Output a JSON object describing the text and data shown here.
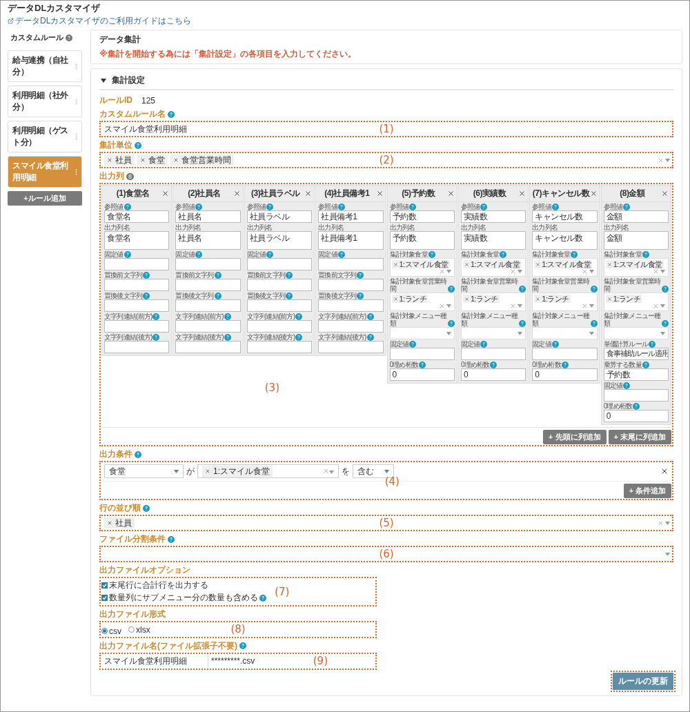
{
  "app": {
    "title": "データDLカスタマイザ",
    "guide_link": "データDLカスタマイザのご利用ガイドはこちら"
  },
  "sidebar": {
    "title": "カスタムルール",
    "items": [
      {
        "label": "給与連携（自社分）",
        "selected": false
      },
      {
        "label": "利用明細（社外分）",
        "selected": false
      },
      {
        "label": "利用明細（ゲスト分）",
        "selected": false
      },
      {
        "label": "スマイル食堂利用明細",
        "selected": true
      }
    ],
    "add_button": "+ルール追加"
  },
  "summary": {
    "title": "データ集計",
    "warning": "※集計を開始する為には「集計設定」の各項目を入力してください。"
  },
  "settings": {
    "heading": "集計設定",
    "expanded": true,
    "rule_id_label": "ルールID",
    "rule_id": "125",
    "rule_name": {
      "label": "カスタムルール名",
      "value": "スマイル食堂利用明細",
      "annotation": "(1)"
    },
    "units": {
      "label": "集計単位",
      "chips": [
        "社員",
        "食堂",
        "食堂営業時間"
      ],
      "annotation": "(2)"
    },
    "output_columns": {
      "label": "出力列",
      "count": "8",
      "annotation": "(3)",
      "columns": [
        {
          "title": "(1)食堂名",
          "fields": [
            {
              "kind": "text",
              "label": "参照値",
              "help": true,
              "value": "食堂名"
            },
            {
              "kind": "textarea",
              "label": "出力列名",
              "help": false,
              "value": "食堂名"
            },
            {
              "kind": "text",
              "label": "固定値",
              "help": true
            },
            {
              "kind": "text",
              "label": "置換前文字列",
              "help": true
            },
            {
              "kind": "text",
              "label": "置換後文字列",
              "help": true
            },
            {
              "kind": "text",
              "label": "文字列連結(前方)",
              "help": true
            },
            {
              "kind": "text",
              "label": "文字列連結(後方)",
              "help": true
            }
          ]
        },
        {
          "title": "(2)社員名",
          "fields": [
            {
              "kind": "text",
              "label": "参照値",
              "help": true,
              "value": "社員名"
            },
            {
              "kind": "textarea",
              "label": "出力列名",
              "help": false,
              "value": "社員名"
            },
            {
              "kind": "text",
              "label": "固定値",
              "help": true
            },
            {
              "kind": "text",
              "label": "置換前文字列",
              "help": true
            },
            {
              "kind": "text",
              "label": "置換後文字列",
              "help": true
            },
            {
              "kind": "text",
              "label": "文字列連結(前方)",
              "help": true
            },
            {
              "kind": "text",
              "label": "文字列連結(後方)",
              "help": true
            }
          ]
        },
        {
          "title": "(3)社員ラベル",
          "fields": [
            {
              "kind": "text",
              "label": "参照値",
              "help": true,
              "value": "社員ラベル"
            },
            {
              "kind": "textarea",
              "label": "出力列名",
              "help": false,
              "value": "社員ラベル"
            },
            {
              "kind": "text",
              "label": "固定値",
              "help": true
            },
            {
              "kind": "text",
              "label": "置換前文字列",
              "help": true
            },
            {
              "kind": "text",
              "label": "置換後文字列",
              "help": true
            },
            {
              "kind": "text",
              "label": "文字列連結(前方)",
              "help": true
            },
            {
              "kind": "text",
              "label": "文字列連結(後方)",
              "help": true
            }
          ]
        },
        {
          "title": "(4)社員備考1",
          "fields": [
            {
              "kind": "text",
              "label": "参照値",
              "help": true,
              "value": "社員備考1"
            },
            {
              "kind": "textarea",
              "label": "出力列名",
              "help": false,
              "value": "社員備考1"
            },
            {
              "kind": "text",
              "label": "固定値",
              "help": true
            },
            {
              "kind": "text",
              "label": "置換前文字列",
              "help": true
            },
            {
              "kind": "text",
              "label": "置換後文字列",
              "help": true
            },
            {
              "kind": "text",
              "label": "文字列連結(前方)",
              "help": true
            },
            {
              "kind": "text",
              "label": "文字列連結(後方)",
              "help": true
            }
          ]
        },
        {
          "title": "(5)予約数",
          "fields": [
            {
              "kind": "text",
              "label": "参照値",
              "help": true,
              "value": "予約数"
            },
            {
              "kind": "textarea",
              "label": "出力列名",
              "help": false,
              "value": "予約数"
            },
            {
              "kind": "multi",
              "label": "集計対象食堂",
              "help": true,
              "chips": [
                "1:スマイル食堂"
              ]
            },
            {
              "kind": "multi",
              "label": "集計対象食堂営業時間",
              "help": true,
              "chips": [
                "1:ランチ"
              ]
            },
            {
              "kind": "select",
              "label": "集計対象メニュー種類",
              "help": true
            },
            {
              "kind": "text",
              "label": "固定値",
              "help": true
            },
            {
              "kind": "text",
              "label": "0埋め桁数",
              "help": true,
              "value": "0"
            }
          ]
        },
        {
          "title": "(6)実績数",
          "fields": [
            {
              "kind": "text",
              "label": "参照値",
              "help": true,
              "value": "実績数"
            },
            {
              "kind": "textarea",
              "label": "出力列名",
              "help": false,
              "value": "実績数"
            },
            {
              "kind": "multi",
              "label": "集計対象食堂",
              "help": true,
              "chips": [
                "1:スマイル食堂"
              ]
            },
            {
              "kind": "multi",
              "label": "集計対象食堂営業時間",
              "help": true,
              "chips": [
                "1:ランチ"
              ]
            },
            {
              "kind": "select",
              "label": "集計対象メニュー種類",
              "help": true
            },
            {
              "kind": "text",
              "label": "固定値",
              "help": true
            },
            {
              "kind": "text",
              "label": "0埋め桁数",
              "help": true,
              "value": "0"
            }
          ]
        },
        {
          "title": "(7)キャンセル数",
          "fields": [
            {
              "kind": "text",
              "label": "参照値",
              "help": true,
              "value": "キャンセル数"
            },
            {
              "kind": "textarea",
              "label": "出力列名",
              "help": false,
              "value": "キャンセル数"
            },
            {
              "kind": "multi",
              "label": "集計対象食堂",
              "help": true,
              "chips": [
                "1:スマイル食堂"
              ]
            },
            {
              "kind": "multi",
              "label": "集計対象食堂営業時間",
              "help": true,
              "chips": [
                "1:ランチ"
              ]
            },
            {
              "kind": "select",
              "label": "集計対象メニュー種類",
              "help": true
            },
            {
              "kind": "text",
              "label": "固定値",
              "help": true
            },
            {
              "kind": "text",
              "label": "0埋め桁数",
              "help": true,
              "value": "0"
            }
          ]
        },
        {
          "title": "(8)金額",
          "fields": [
            {
              "kind": "text",
              "label": "参照値",
              "help": true,
              "value": "金額"
            },
            {
              "kind": "textarea",
              "label": "出力列名",
              "help": false,
              "value": "金額"
            },
            {
              "kind": "multi",
              "label": "集計対象食堂",
              "help": true,
              "chips": [
                "1:スマイル食堂"
              ]
            },
            {
              "kind": "multi",
              "label": "集計対象食堂営業時間",
              "help": true,
              "chips": [
                "1:ランチ"
              ]
            },
            {
              "kind": "select",
              "label": "集計対象メニュー種類",
              "help": true
            },
            {
              "kind": "text",
              "label": "単価計算ルール",
              "help": true,
              "value": "食事補助ルール適用"
            },
            {
              "kind": "text",
              "label": "乗算する数量",
              "help": true,
              "value": "予約数"
            },
            {
              "kind": "text",
              "label": "固定値",
              "help": true
            },
            {
              "kind": "text",
              "label": "0埋め桁数",
              "help": true,
              "value": "0"
            }
          ]
        }
      ],
      "buttons": [
        "+ 先頭に列追加",
        "+ 末尾に列追加"
      ]
    },
    "conditions": {
      "label": "出力条件",
      "annotation": "(4)",
      "rows": [
        {
          "field": "食堂",
          "joiner": "が",
          "chips": [
            "1:スマイル食堂"
          ],
          "operator_joiner": "を",
          "operator": "含む"
        }
      ],
      "add_button": "+ 条件追加"
    },
    "sort_order": {
      "label": "行の並び順",
      "chips": [
        "社員"
      ],
      "annotation": "(5)"
    },
    "file_split": {
      "label": "ファイル分割条件",
      "annotation": "(6)"
    },
    "options": {
      "label": "出力ファイルオプション",
      "annotation": "(7)",
      "items": [
        {
          "label": "末尾行に合計行を出力する",
          "checked": true,
          "help": false
        },
        {
          "label": "数量列にサブメニュー分の数量も含める",
          "checked": true,
          "help": true
        }
      ]
    },
    "format": {
      "label": "出力ファイル形式",
      "annotation": "(8)",
      "options": [
        {
          "label": "csv",
          "selected": true
        },
        {
          "label": "xlsx",
          "selected": false
        }
      ]
    },
    "file_name": {
      "label": "出力ファイル名(ファイル拡張子不要)",
      "value": "スマイル食堂利用明細",
      "suffix": "*********.csv",
      "annotation": "(9)"
    },
    "update_button": {
      "label": "ルールの更新",
      "outlined": true
    }
  }
}
